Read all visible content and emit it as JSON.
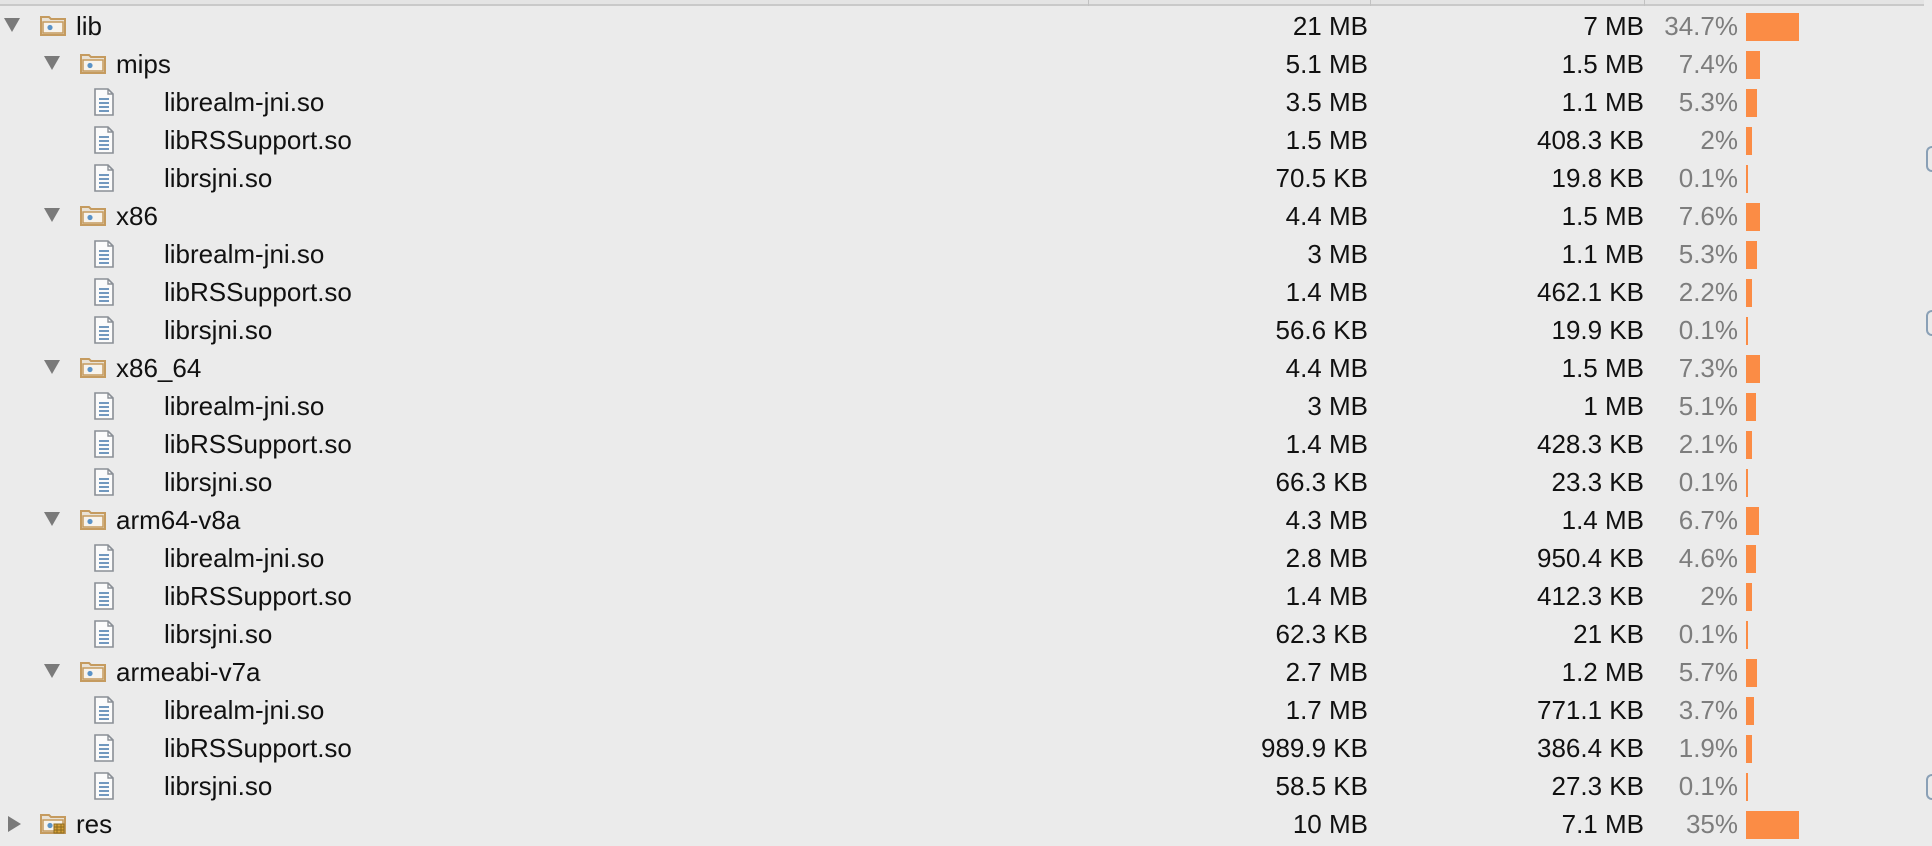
{
  "colors": {
    "background": "#ebebeb",
    "bar": "#fb8c45",
    "percent_text": "#7d7d7d",
    "folder_icon": "#c59b5f"
  },
  "rows": [
    {
      "name": "lib",
      "kind": "folder",
      "depth": 0,
      "expanded": true,
      "size": "21 MB",
      "download": "7 MB",
      "percent": "34.7%",
      "share": 0.347,
      "icon": "folder-icon"
    },
    {
      "name": "mips",
      "kind": "folder",
      "depth": 1,
      "expanded": true,
      "size": "5.1 MB",
      "download": "1.5 MB",
      "percent": "7.4%",
      "share": 0.074,
      "icon": "folder-icon"
    },
    {
      "name": "librealm-jni.so",
      "kind": "file",
      "depth": 2,
      "size": "3.5 MB",
      "download": "1.1 MB",
      "percent": "5.3%",
      "share": 0.053,
      "icon": "file-icon"
    },
    {
      "name": "libRSSupport.so",
      "kind": "file",
      "depth": 2,
      "size": "1.5 MB",
      "download": "408.3 KB",
      "percent": "2%",
      "share": 0.02,
      "icon": "file-icon"
    },
    {
      "name": "librsjni.so",
      "kind": "file",
      "depth": 2,
      "size": "70.5 KB",
      "download": "19.8 KB",
      "percent": "0.1%",
      "share": 0.001,
      "icon": "file-icon"
    },
    {
      "name": "x86",
      "kind": "folder",
      "depth": 1,
      "expanded": true,
      "size": "4.4 MB",
      "download": "1.5 MB",
      "percent": "7.6%",
      "share": 0.076,
      "icon": "folder-icon"
    },
    {
      "name": "librealm-jni.so",
      "kind": "file",
      "depth": 2,
      "size": "3 MB",
      "download": "1.1 MB",
      "percent": "5.3%",
      "share": 0.053,
      "icon": "file-icon"
    },
    {
      "name": "libRSSupport.so",
      "kind": "file",
      "depth": 2,
      "size": "1.4 MB",
      "download": "462.1 KB",
      "percent": "2.2%",
      "share": 0.022,
      "icon": "file-icon"
    },
    {
      "name": "librsjni.so",
      "kind": "file",
      "depth": 2,
      "size": "56.6 KB",
      "download": "19.9 KB",
      "percent": "0.1%",
      "share": 0.001,
      "icon": "file-icon"
    },
    {
      "name": "x86_64",
      "kind": "folder",
      "depth": 1,
      "expanded": true,
      "size": "4.4 MB",
      "download": "1.5 MB",
      "percent": "7.3%",
      "share": 0.073,
      "icon": "folder-icon"
    },
    {
      "name": "librealm-jni.so",
      "kind": "file",
      "depth": 2,
      "size": "3 MB",
      "download": "1 MB",
      "percent": "5.1%",
      "share": 0.051,
      "icon": "file-icon"
    },
    {
      "name": "libRSSupport.so",
      "kind": "file",
      "depth": 2,
      "size": "1.4 MB",
      "download": "428.3 KB",
      "percent": "2.1%",
      "share": 0.021,
      "icon": "file-icon"
    },
    {
      "name": "librsjni.so",
      "kind": "file",
      "depth": 2,
      "size": "66.3 KB",
      "download": "23.3 KB",
      "percent": "0.1%",
      "share": 0.001,
      "icon": "file-icon"
    },
    {
      "name": "arm64-v8a",
      "kind": "folder",
      "depth": 1,
      "expanded": true,
      "size": "4.3 MB",
      "download": "1.4 MB",
      "percent": "6.7%",
      "share": 0.067,
      "icon": "folder-icon"
    },
    {
      "name": "librealm-jni.so",
      "kind": "file",
      "depth": 2,
      "size": "2.8 MB",
      "download": "950.4 KB",
      "percent": "4.6%",
      "share": 0.046,
      "icon": "file-icon"
    },
    {
      "name": "libRSSupport.so",
      "kind": "file",
      "depth": 2,
      "size": "1.4 MB",
      "download": "412.3 KB",
      "percent": "2%",
      "share": 0.02,
      "icon": "file-icon"
    },
    {
      "name": "librsjni.so",
      "kind": "file",
      "depth": 2,
      "size": "62.3 KB",
      "download": "21 KB",
      "percent": "0.1%",
      "share": 0.001,
      "icon": "file-icon"
    },
    {
      "name": "armeabi-v7a",
      "kind": "folder",
      "depth": 1,
      "expanded": true,
      "size": "2.7 MB",
      "download": "1.2 MB",
      "percent": "5.7%",
      "share": 0.057,
      "icon": "folder-icon"
    },
    {
      "name": "librealm-jni.so",
      "kind": "file",
      "depth": 2,
      "size": "1.7 MB",
      "download": "771.1 KB",
      "percent": "3.7%",
      "share": 0.037,
      "icon": "file-icon"
    },
    {
      "name": "libRSSupport.so",
      "kind": "file",
      "depth": 2,
      "size": "989.9 KB",
      "download": "386.4 KB",
      "percent": "1.9%",
      "share": 0.019,
      "icon": "file-icon"
    },
    {
      "name": "librsjni.so",
      "kind": "file",
      "depth": 2,
      "size": "58.5 KB",
      "download": "27.3 KB",
      "percent": "0.1%",
      "share": 0.001,
      "icon": "file-icon"
    },
    {
      "name": "res",
      "kind": "resource-folder",
      "depth": 0,
      "expanded": false,
      "size": "10 MB",
      "download": "7.1 MB",
      "percent": "35%",
      "share": 0.35,
      "icon": "resource-folder-icon"
    }
  ]
}
